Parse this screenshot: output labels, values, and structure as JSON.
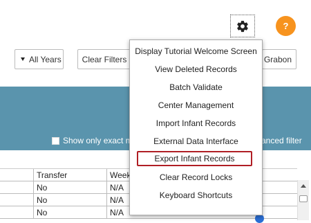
{
  "toolbar": {
    "gear_icon": "gear-icon",
    "help_label": "?",
    "years_label": "All Years",
    "clear_filters_label": "Clear Filters",
    "partial_button_label": "Grabon"
  },
  "filter_band": {
    "exact_match_label": "Show only exact m",
    "advanced_filter_label": "anced filter"
  },
  "grid": {
    "headers": [
      "Transfer",
      "Week"
    ],
    "rows": [
      [
        "No",
        "N/A"
      ],
      [
        "No",
        "N/A"
      ],
      [
        "No",
        "N/A"
      ]
    ]
  },
  "settings_menu": {
    "items": [
      "Display Tutorial Welcome Screen",
      "View Deleted Records",
      "Batch Validate",
      "Center Management",
      "Import Infant Records",
      "External Data Interface",
      "Export Infant Records",
      "Clear Record Locks",
      "Keyboard Shortcuts"
    ],
    "highlighted_item": "Export Infant Records",
    "highlight_color": "#b01e24"
  },
  "colors": {
    "band": "#5a94ad",
    "help_button": "#f7931e"
  }
}
